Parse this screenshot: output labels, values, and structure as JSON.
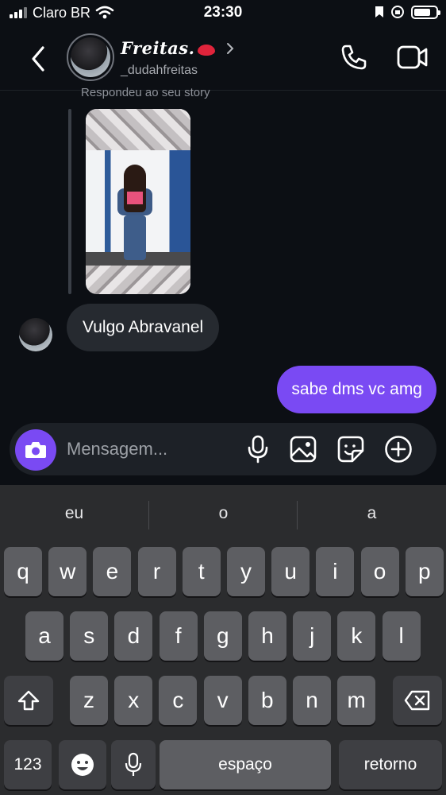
{
  "status_bar": {
    "carrier": "Claro BR",
    "time": "23:30",
    "battery_level": 0.75
  },
  "header": {
    "name": "Freitas.",
    "username": "_dudahfreitas",
    "icons": {
      "back": "back-chevron-icon",
      "profile_chevron": "chevron-right-icon",
      "call": "phone-icon",
      "video": "video-camera-icon"
    }
  },
  "chat": {
    "story_reply_label": "Respondeu ao seu story",
    "incoming_message": "Vulgo Abravanel",
    "outgoing_message": "sabe dms vc amg"
  },
  "composer": {
    "placeholder": "Mensagem...",
    "accent_color": "#7a4af3",
    "icons": [
      "camera-icon",
      "microphone-icon",
      "image-icon",
      "sticker-icon",
      "plus-circle-icon"
    ]
  },
  "keyboard": {
    "suggestions": [
      "eu",
      "o",
      "a"
    ],
    "row1": [
      "q",
      "w",
      "e",
      "r",
      "t",
      "y",
      "u",
      "i",
      "o",
      "p"
    ],
    "row2": [
      "a",
      "s",
      "d",
      "f",
      "g",
      "h",
      "j",
      "k",
      "l"
    ],
    "row3": [
      "z",
      "x",
      "c",
      "v",
      "b",
      "n",
      "m"
    ],
    "numbers_key": "123",
    "space_key": "espaço",
    "return_key": "retorno"
  }
}
